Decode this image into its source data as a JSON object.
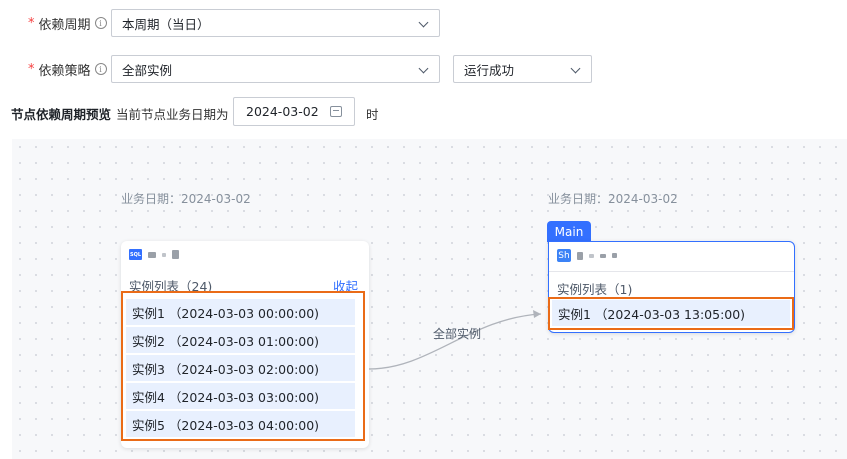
{
  "form": {
    "period": {
      "label": "依赖周期",
      "required_mark": "*",
      "info_icon": "ⓘ",
      "value": "本周期（当日）"
    },
    "strategy": {
      "label": "依赖策略",
      "required_mark": "*",
      "info_icon": "ⓘ",
      "value": "全部实例",
      "status_value": "运行成功"
    }
  },
  "preview": {
    "title": "节点依赖周期预览",
    "current_label": "当前节点业务日期为",
    "date_value": "2024-03-02",
    "hour_suffix": "时"
  },
  "graph": {
    "upstream": {
      "biz_date": "业务日期：2024-03-02",
      "badge": "SQL",
      "list_header": "实例列表（24)",
      "collapse_label": "收起",
      "instances": [
        "实例1 （2024-03-03 00:00:00)",
        "实例2 （2024-03-03 01:00:00)",
        "实例3 （2024-03-03 02:00:00)",
        "实例4 （2024-03-03 03:00:00)",
        "实例5 （2024-03-03 04:00:00)"
      ]
    },
    "edge_label": "全部实例",
    "downstream": {
      "biz_date": "业务日期：2024-03-02",
      "tag": "Main",
      "badge": "Sh",
      "list_header": "实例列表（1)",
      "instances": [
        "实例1 （2024-03-03 13:05:00)"
      ]
    }
  },
  "colors": {
    "accent": "#3370ff",
    "highlight": "#ea6b17",
    "instance_bg": "#e8f0fe",
    "required": "#f53f3f"
  }
}
